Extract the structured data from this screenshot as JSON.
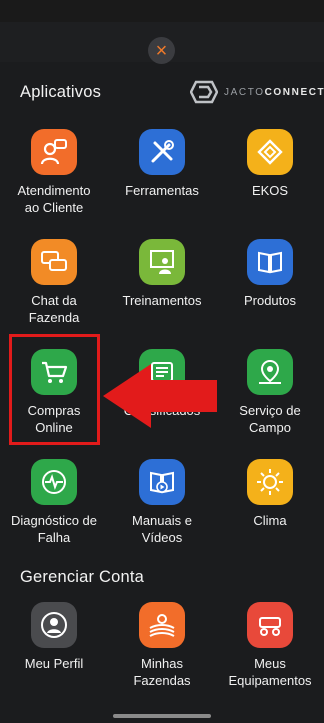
{
  "close_label": "×",
  "apps_section": {
    "title": "Aplicativos"
  },
  "brand": {
    "prefix": "JACTO",
    "suffix": "CONNECT"
  },
  "apps": [
    {
      "label": "Atendimento\nao Cliente",
      "icon": "chat-person-icon",
      "color": "#f26d2a"
    },
    {
      "label": "Ferramentas",
      "icon": "tools-icon",
      "color": "#2d6fd6"
    },
    {
      "label": "EKOS",
      "icon": "ekos-icon",
      "color": "#f4b11a"
    },
    {
      "label": "Chat da\nFazenda",
      "icon": "chat-bubbles-icon",
      "color": "#f28b26"
    },
    {
      "label": "Treinamentos",
      "icon": "training-board-icon",
      "color": "#7ab83a"
    },
    {
      "label": "Produtos",
      "icon": "book-icon",
      "color": "#2d6fd6"
    },
    {
      "label": "Compras\nOnline",
      "icon": "shopping-cart-icon",
      "color": "#2ea84a"
    },
    {
      "label": "Classificados",
      "icon": "classifieds-icon",
      "color": "#2ea84a"
    },
    {
      "label": "Serviço de\nCampo",
      "icon": "map-pin-icon",
      "color": "#2ea84a"
    },
    {
      "label": "Diagnóstico de\nFalha",
      "icon": "diagnostic-icon",
      "color": "#2ea84a"
    },
    {
      "label": "Manuais e\nVídeos",
      "icon": "manual-video-icon",
      "color": "#2d6fd6"
    },
    {
      "label": "Clima",
      "icon": "sun-icon",
      "color": "#f4b11a"
    }
  ],
  "account_section": {
    "title": "Gerenciar Conta"
  },
  "account_apps": [
    {
      "label": "Meu Perfil",
      "icon": "profile-icon",
      "color": "#4a4b4e"
    },
    {
      "label": "Minhas\nFazendas",
      "icon": "farm-icon",
      "color": "#f26d2a"
    },
    {
      "label": "Meus\nEquipamentos",
      "icon": "equipment-icon",
      "color": "#e8493a"
    }
  ],
  "annotation": {
    "highlight_color": "#e21b1b"
  }
}
